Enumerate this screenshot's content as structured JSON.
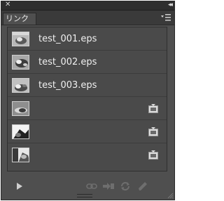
{
  "panel": {
    "tab_label": "リンク"
  },
  "links": [
    {
      "filename": "test_001.eps",
      "has_embed_icon": false
    },
    {
      "filename": "test_002.eps",
      "has_embed_icon": false
    },
    {
      "filename": "test_003.eps",
      "has_embed_icon": false
    },
    {
      "filename": "",
      "has_embed_icon": true
    },
    {
      "filename": "",
      "has_embed_icon": true
    },
    {
      "filename": "",
      "has_embed_icon": true
    }
  ],
  "icons": {
    "close": "close-icon",
    "collapse": "double-chevron-icon",
    "panel_menu": "panel-menu-icon",
    "embed": "embedded-link-icon",
    "show_options": "triangle-right-icon",
    "relink": "chain-link-icon",
    "goto_link": "goto-link-icon",
    "update": "refresh-icon",
    "edit_original": "pencil-icon",
    "resize": "resize-grip-icon"
  },
  "colors": {
    "panel_bg": "#4f4f4f",
    "list_bg": "#4a4a4a",
    "titlebar_bg": "#2e2e2e",
    "text": "#f0f0f0"
  }
}
